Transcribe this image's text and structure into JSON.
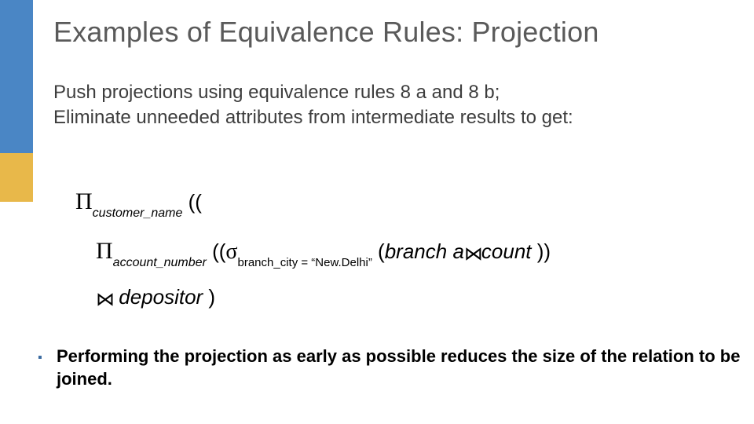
{
  "title": "Examples of Equivalence Rules: Projection",
  "intro_line1": "Push projections using equivalence rules 8 a and 8 b;",
  "intro_line2": "Eliminate unneeded attributes from intermediate results to get:",
  "expr": {
    "pi1_sub": "customer_name",
    "open1": " ((",
    "pi2_sub": "account_number",
    "open2": " ((",
    "sigma_sub": "branch_city = “New.Delhi”",
    "open_rel": " (",
    "rel1": "branch",
    "gap": "     ",
    "rel2_pre": "a",
    "rel2_post": "count",
    "close2": " ))",
    "rel3": "depositor",
    "close1": " )"
  },
  "symbols": {
    "Pi": "Π",
    "sigma": "σ",
    "join": "⋈"
  },
  "bullet": "▪",
  "point": "Performing the projection as early as possible reduces the size of the relation to be joined."
}
